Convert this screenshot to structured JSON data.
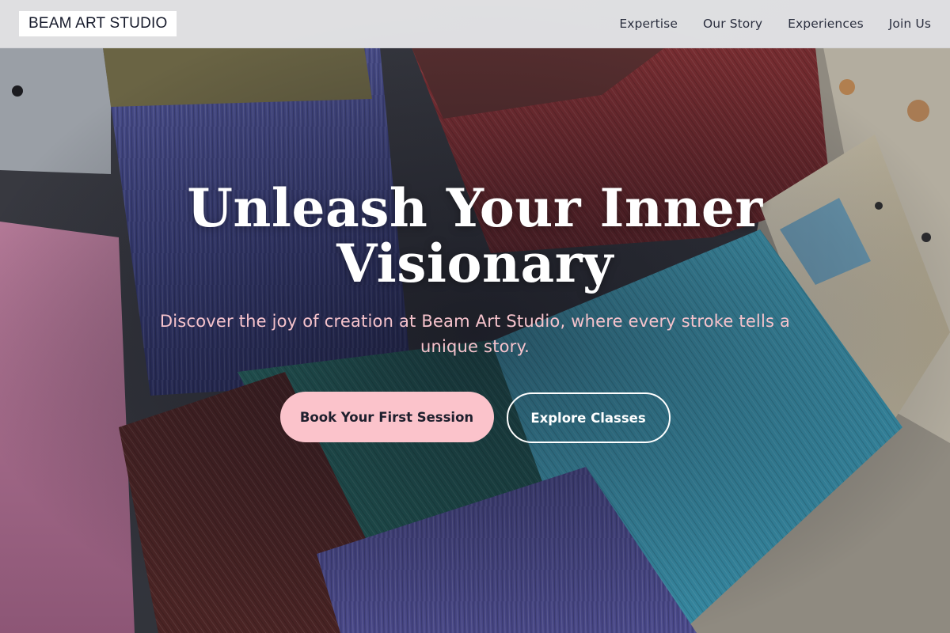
{
  "header": {
    "logo_text": "BEAM ART STUDIO",
    "nav": [
      {
        "label": "Expertise"
      },
      {
        "label": "Our Story"
      },
      {
        "label": "Experiences"
      },
      {
        "label": "Join Us"
      }
    ]
  },
  "hero": {
    "title": "Unleash Your Inner Visionary",
    "subtitle": "Discover the joy of creation at Beam Art Studio, where every stroke tells a unique story.",
    "primary_cta": "Book Your First Session",
    "secondary_cta": "Explore Classes"
  },
  "colors": {
    "header_bg": "#ececee",
    "accent_pink": "#fbc3cb",
    "subtitle_pink": "#f6c3cc",
    "title_white": "#ffffff",
    "text_dark": "#1e1f2d"
  },
  "background": {
    "image": "paint-brushes-photo"
  }
}
